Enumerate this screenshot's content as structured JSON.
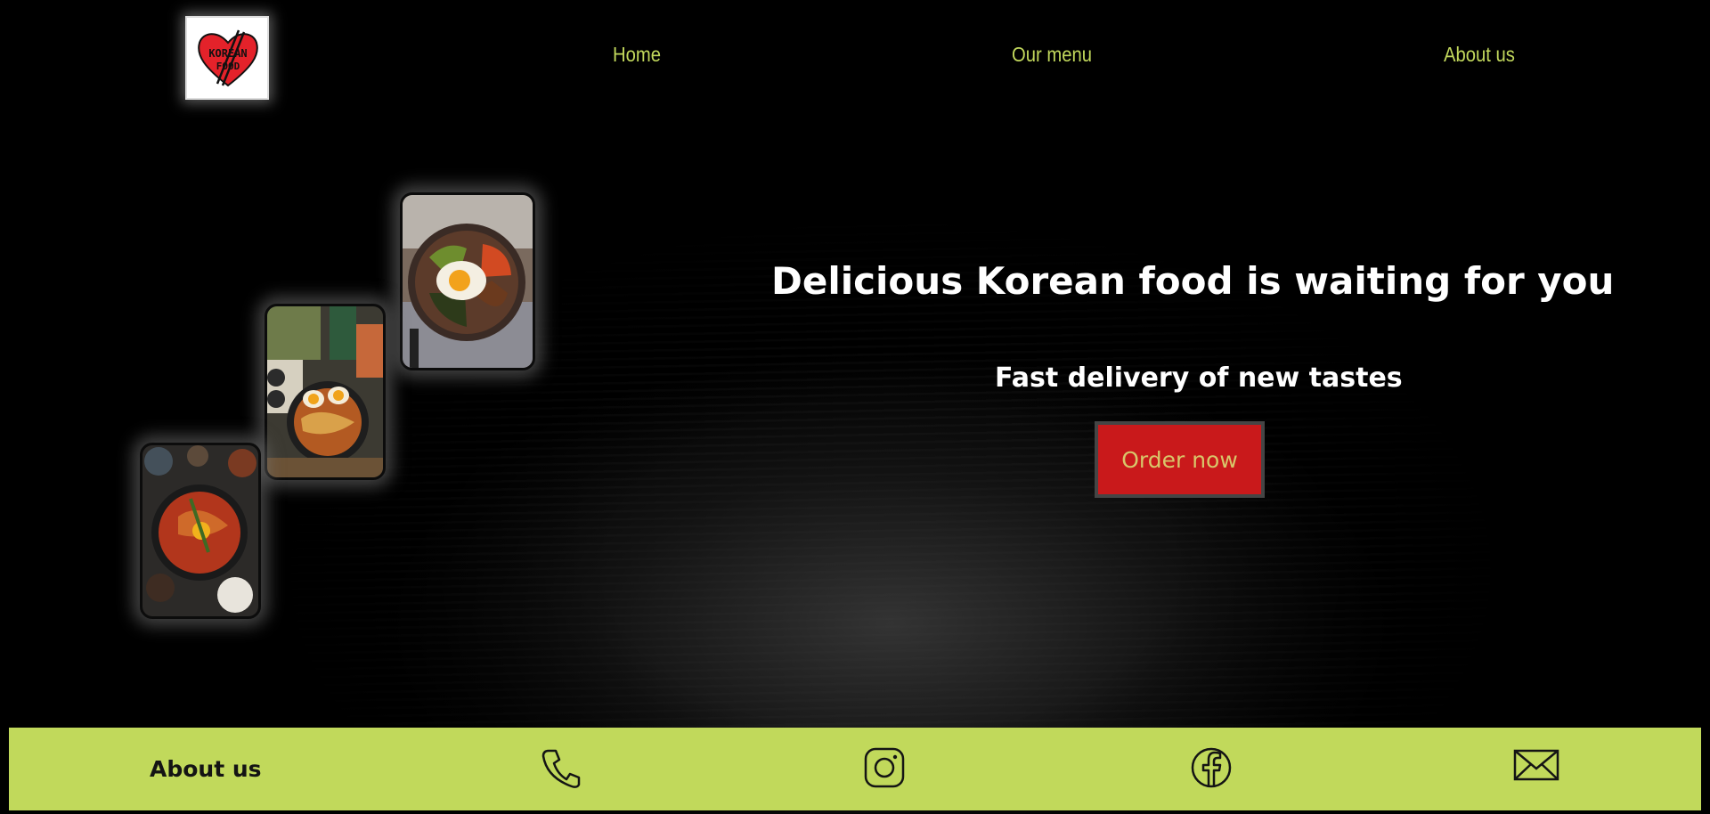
{
  "header": {
    "logo_text_line1": "KOREAN",
    "logo_text_line2": "FOOD",
    "nav": [
      {
        "label": "Home"
      },
      {
        "label": "Our menu"
      },
      {
        "label": "About us"
      }
    ]
  },
  "hero": {
    "title": "Delicious Korean food is waiting for you",
    "subtitle": "Fast delivery of new tastes",
    "cta_label": "Order now"
  },
  "cards": [
    {
      "icon": "bibimbap-photo"
    },
    {
      "icon": "ramen-table-photo"
    },
    {
      "icon": "spicy-stew-photo"
    }
  ],
  "footer": {
    "about_label": "About us",
    "icons": [
      "phone-icon",
      "instagram-icon",
      "facebook-icon",
      "mail-icon"
    ]
  },
  "colors": {
    "accent": "#c1d95b",
    "button": "#c9191b",
    "button_text": "#d8c66a",
    "nav_text": "#c2d85c",
    "background": "#000000"
  }
}
